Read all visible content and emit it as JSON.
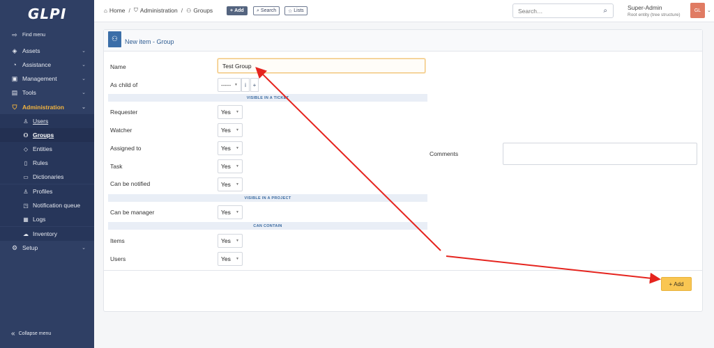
{
  "app": {
    "logo": "GLPI"
  },
  "sidebar": {
    "find_menu": "Find menu",
    "items": [
      {
        "label": "Assets",
        "icon": "cube-icon"
      },
      {
        "label": "Assistance",
        "icon": "headset-icon"
      },
      {
        "label": "Management",
        "icon": "wallet-icon"
      },
      {
        "label": "Tools",
        "icon": "briefcase-icon"
      },
      {
        "label": "Administration",
        "icon": "shield-icon"
      },
      {
        "label": "Setup",
        "icon": "gear-icon"
      }
    ],
    "sub_items": [
      {
        "label": "Users",
        "icon": "user-icon"
      },
      {
        "label": "Groups",
        "icon": "users-icon"
      },
      {
        "label": "Entities",
        "icon": "layers-icon"
      },
      {
        "label": "Rules",
        "icon": "book-icon"
      },
      {
        "label": "Dictionaries",
        "icon": "book-open-icon"
      },
      {
        "label": "Profiles",
        "icon": "user-check-icon"
      },
      {
        "label": "Notification queue",
        "icon": "notification-icon"
      },
      {
        "label": "Logs",
        "icon": "news-icon"
      },
      {
        "label": "Inventory",
        "icon": "cloud-icon"
      }
    ],
    "collapse": "Collapse menu"
  },
  "topbar": {
    "breadcrumb": [
      "Home",
      "Administration",
      "Groups"
    ],
    "add": "Add",
    "search_btn": "Search",
    "lists": "Lists",
    "search_placeholder": "Search…",
    "user_name": "Super-Admin",
    "user_entity": "Root entity (tree structure)",
    "avatar": "GL"
  },
  "form": {
    "title": "New item - Group",
    "name_label": "Name",
    "name_value": "Test Group",
    "child_label": "As child of",
    "child_value": "-----",
    "info_btn": "i",
    "plus_btn": "+",
    "section_ticket": "VISIBLE IN A TICKET",
    "section_project": "VISIBLE IN A PROJECT",
    "section_contain": "CAN CONTAIN",
    "rows_ticket": [
      {
        "label": "Requester",
        "value": "Yes"
      },
      {
        "label": "Watcher",
        "value": "Yes"
      },
      {
        "label": "Assigned to",
        "value": "Yes"
      },
      {
        "label": "Task",
        "value": "Yes"
      },
      {
        "label": "Can be notified",
        "value": "Yes"
      }
    ],
    "rows_project": [
      {
        "label": "Can be manager",
        "value": "Yes"
      }
    ],
    "rows_contain": [
      {
        "label": "Items",
        "value": "Yes"
      },
      {
        "label": "Users",
        "value": "Yes"
      }
    ],
    "comments_label": "Comments",
    "add_button": "Add"
  },
  "colors": {
    "sidebar": "#2f3f64",
    "accent": "#f4b53f",
    "add_button": "#f9c652",
    "arrow": "#e5241e"
  }
}
